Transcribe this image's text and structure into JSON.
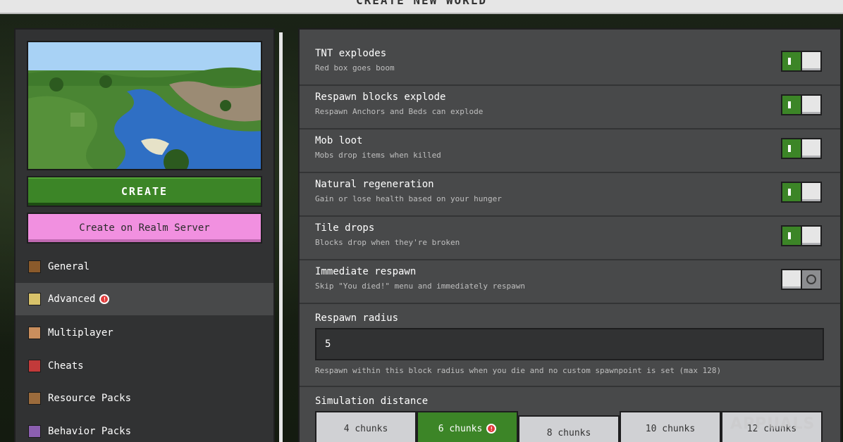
{
  "header": {
    "title": "CREATE NEW WORLD"
  },
  "left": {
    "create_label": "CREATE",
    "realm_label": "Create on Realm Server",
    "nav": [
      {
        "label": "General",
        "icon": "general-icon",
        "color": "#8a5a2b"
      },
      {
        "label": "Advanced",
        "icon": "advanced-icon",
        "color": "#d8c26a",
        "badge": true
      },
      {
        "label": "Multiplayer",
        "icon": "multiplayer-icon",
        "color": "#c98e5d"
      },
      {
        "label": "Cheats",
        "icon": "cheats-icon",
        "color": "#c23a3a"
      },
      {
        "label": "Resource Packs",
        "icon": "resource-packs-icon",
        "color": "#9b6b3c"
      },
      {
        "label": "Behavior Packs",
        "icon": "behavior-packs-icon",
        "color": "#8b5fb0"
      }
    ]
  },
  "settings": [
    {
      "title": "TNT explodes",
      "desc": "Red box goes boom",
      "on": true
    },
    {
      "title": "Respawn blocks explode",
      "desc": "Respawn Anchors and Beds can explode",
      "on": true
    },
    {
      "title": "Mob loot",
      "desc": "Mobs drop items when killed",
      "on": true
    },
    {
      "title": "Natural regeneration",
      "desc": "Gain or lose health based on your hunger",
      "on": true
    },
    {
      "title": "Tile drops",
      "desc": "Blocks drop when they're broken",
      "on": true
    },
    {
      "title": "Immediate respawn",
      "desc": "Skip \"You died!\" menu and immediately respawn",
      "on": false
    }
  ],
  "respawn_radius": {
    "label": "Respawn radius",
    "value": "5",
    "desc": "Respawn within this block radius when you die and no custom spawnpoint is set (max 128)"
  },
  "simulation": {
    "label": "Simulation distance",
    "options": [
      "4 chunks",
      "6 chunks",
      "8 chunks",
      "10 chunks",
      "12 chunks"
    ],
    "selected": "6 chunks"
  },
  "watermark": "APPUALS",
  "colors": {
    "green": "#3c8527",
    "pink": "#f190e0",
    "panel": "#48494a"
  }
}
